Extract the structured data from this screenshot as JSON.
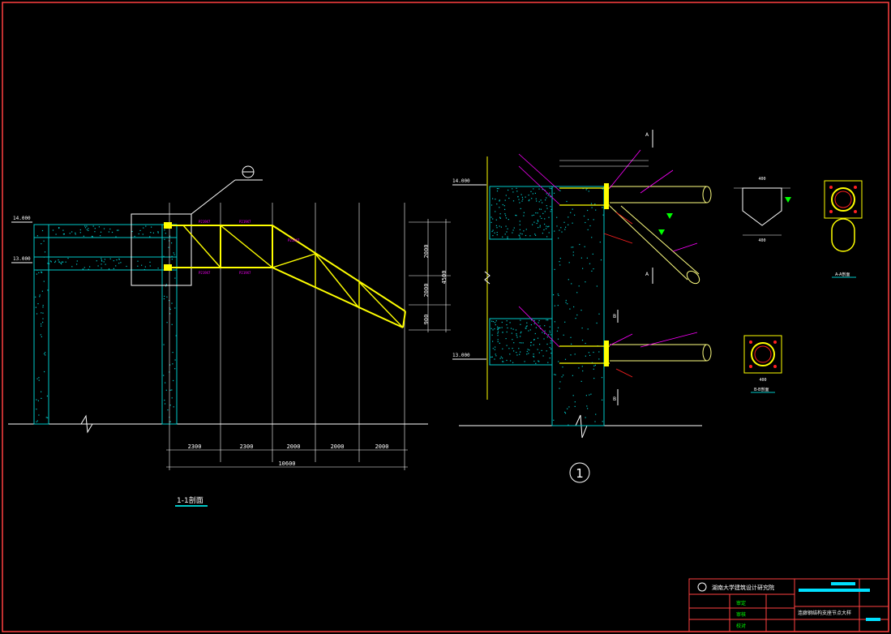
{
  "left_section": {
    "title": "1-1剖面",
    "elevations": {
      "top": "14.000",
      "bottom": "13.000"
    },
    "h_dims": [
      "2300",
      "2300",
      "2000",
      "2000",
      "2000"
    ],
    "h_total": "10600",
    "v_dims": [
      "2000",
      "2000",
      "900"
    ],
    "v_total": "4500"
  },
  "right_section": {
    "elevations": {
      "top": "14.000",
      "bottom": "13.000"
    },
    "bubble_label": "1",
    "section_marks": [
      "A",
      "A",
      "B",
      "B"
    ],
    "detail_a_title": "A-A剖面",
    "detail_b_title": "B-B剖面",
    "dims_a": [
      "400",
      "200",
      "400"
    ],
    "dims_b": [
      "400",
      "200"
    ]
  },
  "title_block": {
    "org": "湖南大学建筑设计研究院",
    "drawing_title": "连廊钢结构支座节点大样",
    "stamps": [
      "审定",
      "审核",
      "校对"
    ]
  },
  "colors": {
    "bg": "#000000",
    "border": "#ff4040",
    "concrete": "#00c8c8",
    "steel": "#ffff00",
    "pipe": "#ffff80",
    "text_dim": "#ffffff",
    "magenta": "#ff00ff",
    "red": "#ff2020",
    "green": "#00ff00"
  }
}
